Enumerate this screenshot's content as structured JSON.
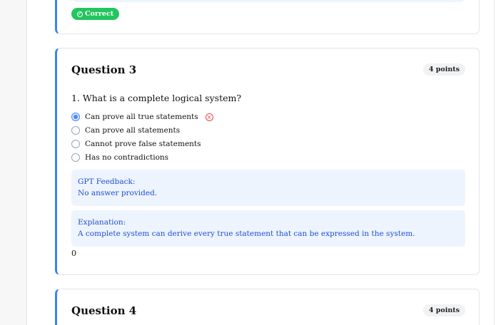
{
  "previous": {
    "status_badge": "Correct",
    "status_icon": "✓"
  },
  "q3": {
    "title": "Question 3",
    "points": "4 points",
    "question": "1. What is a complete logical system?",
    "options": [
      "Can prove all true statements",
      "Can prove all statements",
      "Cannot prove false statements",
      "Has no contradictions"
    ],
    "wrong_icon": "×",
    "gpt_feedback_label": "GPT Feedback:",
    "gpt_feedback_text": "No answer provided.",
    "explanation_label": "Explanation:",
    "explanation_text": "A complete system can derive every true statement that can be expressed in the system.",
    "score": "0"
  },
  "q4": {
    "title": "Question 4",
    "points": "4 points"
  },
  "colors": {
    "accent": "#3b82f6",
    "correct": "#22c55e",
    "wrong": "#ef4444",
    "feedback_bg": "#eef4fd",
    "feedback_text": "#1d4ed8"
  }
}
